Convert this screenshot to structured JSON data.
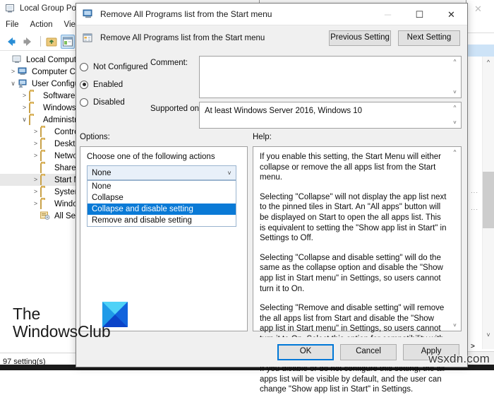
{
  "background_window": {
    "title": "Local Group Policy Editor",
    "title_icon": "policy-editor-icon",
    "menu": [
      {
        "label": "File"
      },
      {
        "label": "Action"
      },
      {
        "label": "View"
      }
    ],
    "toolbar": [
      {
        "icon": "back-arrow-icon"
      },
      {
        "icon": "forward-arrow-icon"
      },
      {
        "icon": "up-folder-icon"
      },
      {
        "icon": "properties-icon"
      },
      {
        "icon": "list-view-icon"
      }
    ],
    "tree": [
      {
        "label": "Local Computer P",
        "chevron": "",
        "icon": "policy-icon",
        "indent": 0,
        "selected": false
      },
      {
        "label": "Computer Con",
        "chevron": ">",
        "icon": "computer-icon",
        "indent": 1,
        "selected": false
      },
      {
        "label": "User Configura",
        "chevron": "∨",
        "icon": "user-icon",
        "indent": 1,
        "selected": false
      },
      {
        "label": "Software Se",
        "chevron": ">",
        "icon": "folder-icon",
        "indent": 2,
        "selected": false
      },
      {
        "label": "Windows S",
        "chevron": ">",
        "icon": "folder-icon",
        "indent": 2,
        "selected": false
      },
      {
        "label": "Administra",
        "chevron": "∨",
        "icon": "folder-icon",
        "indent": 2,
        "selected": false
      },
      {
        "label": "Control",
        "chevron": ">",
        "icon": "folder-icon",
        "indent": 3,
        "selected": false
      },
      {
        "label": "Desktop",
        "chevron": ">",
        "icon": "folder-icon",
        "indent": 3,
        "selected": false
      },
      {
        "label": "Networ",
        "chevron": ">",
        "icon": "folder-icon",
        "indent": 3,
        "selected": false
      },
      {
        "label": "Shared",
        "chevron": "",
        "icon": "folder-icon",
        "indent": 3,
        "selected": false
      },
      {
        "label": "Start M",
        "chevron": ">",
        "icon": "folder-icon",
        "indent": 3,
        "selected": true
      },
      {
        "label": "System",
        "chevron": ">",
        "icon": "folder-icon",
        "indent": 3,
        "selected": false
      },
      {
        "label": "Window",
        "chevron": ">",
        "icon": "folder-icon",
        "indent": 3,
        "selected": false
      },
      {
        "label": "All Setti",
        "chevron": "",
        "icon": "all-settings-icon",
        "indent": 3,
        "selected": false
      }
    ],
    "status": "97 setting(s)"
  },
  "dialog": {
    "title": "Remove All Programs list from the Start menu",
    "title_icon": "policy-setting-icon",
    "window_controls": {
      "minimize": "─",
      "maximize": "☐",
      "close": "✕"
    },
    "subheader": {
      "icon": "policy-doc-icon",
      "title": "Remove All Programs list from the Start menu",
      "previous_label": "Previous Setting",
      "next_label": "Next Setting"
    },
    "state": {
      "options": [
        {
          "label": "Not Configured",
          "selected": false
        },
        {
          "label": "Enabled",
          "selected": true
        },
        {
          "label": "Disabled",
          "selected": false
        }
      ]
    },
    "comment": {
      "label": "Comment:",
      "value": ""
    },
    "supported_on": {
      "label": "Supported on:",
      "value": "At least Windows Server 2016, Windows 10"
    },
    "options_panel": {
      "label": "Options:",
      "caption": "Choose one of the following actions",
      "combo": {
        "selected": "None",
        "chevron_icon": "chevron-down-icon",
        "expanded": true,
        "items": [
          {
            "label": "None",
            "highlighted": false
          },
          {
            "label": "Collapse",
            "highlighted": false
          },
          {
            "label": "Collapse and disable setting",
            "highlighted": true
          },
          {
            "label": "Remove and disable setting",
            "highlighted": false
          }
        ]
      }
    },
    "help_panel": {
      "label": "Help:",
      "paragraphs": [
        "If you enable this setting, the Start Menu will either collapse or remove the all apps list from the Start menu.",
        "Selecting \"Collapse\" will not display the app list next to the pinned tiles in Start. An \"All apps\" button will be displayed on Start to open the all apps list. This is equivalent to setting the \"Show app list in Start\" in Settings to Off.",
        "Selecting \"Collapse and disable setting\" will do the same as the collapse option and disable the \"Show app list in Start menu\" in Settings, so users cannot turn it to On.",
        "Selecting \"Remove and disable setting\" will remove the all apps list from Start and disable the \"Show app list in Start menu\" in Settings, so users cannot turn it to On. Select this option for compatibility with earlier versions of Windows.",
        "If you disable or do not configure this setting, the all apps list will be visible by default, and the user can change \"Show app list in Start\" in Settings."
      ]
    },
    "footer": {
      "ok_label": "OK",
      "cancel_label": "Cancel",
      "apply_label": "Apply"
    }
  },
  "watermarks": {
    "brand_line1": "The",
    "brand_line2": "WindowsClub",
    "brand_logo_icon": "windowsclub-logo-icon",
    "site": "wsxdn.com"
  },
  "colors": {
    "accent": "#0a7ad6",
    "default_button_border": "#0078d7",
    "combo_fill": "#e8f0f9",
    "folder": "#ecc97c",
    "dialog_bg": "#f0f0f0"
  }
}
